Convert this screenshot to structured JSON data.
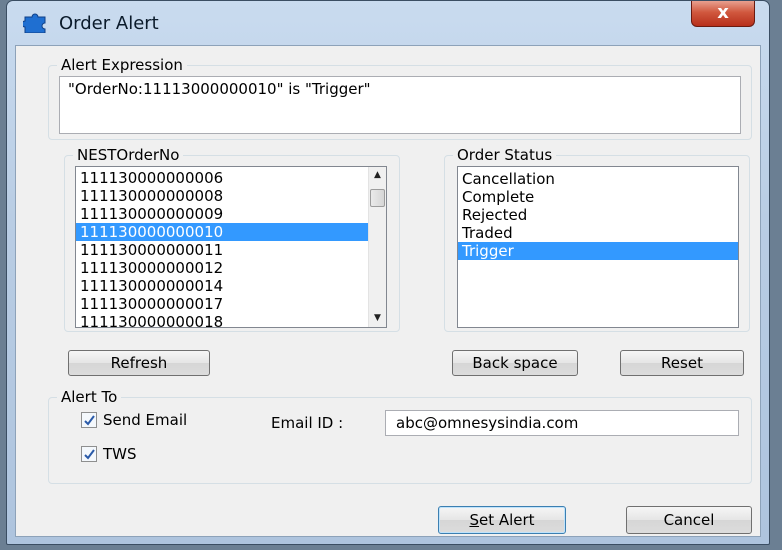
{
  "window": {
    "title": "Order Alert",
    "close_glyph": "x"
  },
  "alert_expression": {
    "legend": "Alert Expression",
    "value": "\"OrderNo:11113000000010\" is \"Trigger\""
  },
  "nest_order_no": {
    "legend": "NESTOrderNo",
    "items": [
      "111130000000006",
      "111130000000008",
      "111130000000009",
      "111130000000010",
      "111130000000011",
      "111130000000012",
      "111130000000014",
      "111130000000017",
      "111130000000018"
    ],
    "selected_index": 3
  },
  "order_status": {
    "legend": "Order Status",
    "items": [
      "Cancellation",
      "Complete",
      "Rejected",
      "Traded",
      "Trigger"
    ],
    "selected_index": 4
  },
  "buttons": {
    "refresh": "Refresh",
    "back_space": "Back space",
    "reset": "Reset",
    "set_alert_prefix": "S",
    "set_alert_rest": "et Alert",
    "cancel": "Cancel"
  },
  "alert_to": {
    "legend": "Alert To",
    "send_email_label": "Send Email",
    "send_email_checked": true,
    "tws_label": "TWS",
    "tws_checked": true,
    "email_id_label": "Email ID :",
    "email_id_value": "abc@omnesysindia.com"
  },
  "colors": {
    "selection": "#3399ff",
    "close_button": "#c8452c"
  },
  "icons": {
    "app": "puzzle-icon",
    "close": "close-icon",
    "scroll_up": "chevron-up-icon",
    "scroll_down": "chevron-down-icon",
    "check": "check-icon"
  }
}
